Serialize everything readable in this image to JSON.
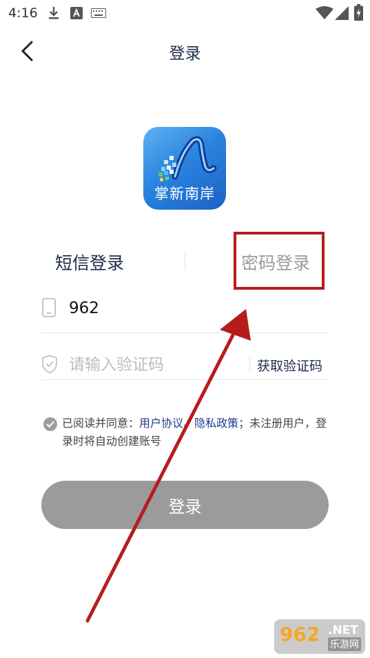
{
  "status_bar": {
    "time": "4:16"
  },
  "header": {
    "title": "登录"
  },
  "logo": {
    "text": "掌新南岸"
  },
  "tabs": [
    {
      "label": "短信登录",
      "active": true
    },
    {
      "label": "密码登录",
      "active": false
    }
  ],
  "phone": {
    "value": "962"
  },
  "code": {
    "placeholder": "请输入验证码",
    "get_code_label": "获取验证码"
  },
  "agreement": {
    "prefix": "已阅读并同意：",
    "user_agreement": "用户协议",
    "separator": "、",
    "privacy_policy": "隐私政策",
    "suffix": "；未注册用户，登录时将自动创建账号"
  },
  "login_button": {
    "label": "登录"
  },
  "watermark": {
    "number": "962",
    "domain": ".NET",
    "name": "乐游网"
  },
  "colors": {
    "accent": "#1f2a4d",
    "highlight": "#b71c1c",
    "button": "#9b9b9b"
  }
}
